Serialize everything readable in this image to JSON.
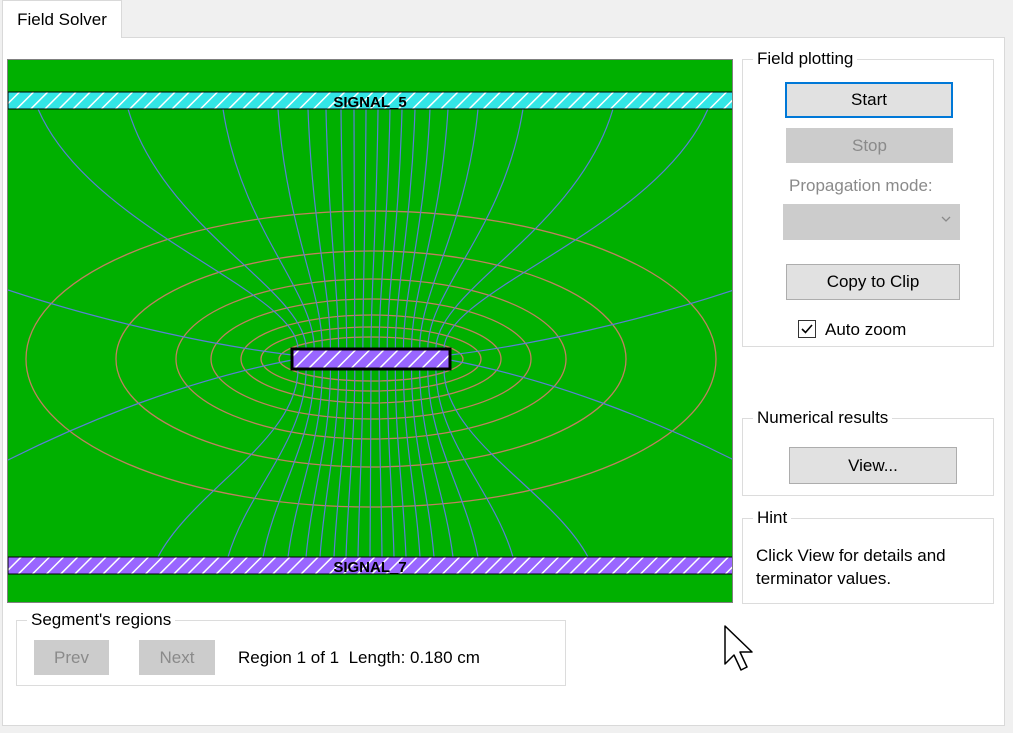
{
  "window": {
    "tab_label": "Field Solver"
  },
  "plot": {
    "top_conductor_label": "SIGNAL_5",
    "bottom_conductor_label": "SIGNAL_7",
    "colors": {
      "background": "#00b000",
      "top_conductor": "#33e6e6",
      "trace_and_bottom": "#9966ff",
      "equipotential_lines": "#c08060",
      "field_lines": "#5a7fd6"
    }
  },
  "field_plotting": {
    "title": "Field plotting",
    "start_label": "Start",
    "stop_label": "Stop",
    "propagation_mode_label": "Propagation mode:",
    "propagation_mode_value": "",
    "copy_label": "Copy to Clip",
    "auto_zoom_label": "Auto zoom",
    "auto_zoom_checked": true
  },
  "numerical_results": {
    "title": "Numerical results",
    "view_label": "View..."
  },
  "hint": {
    "title": "Hint",
    "line1": "Click View for details and",
    "line2": "terminator values."
  },
  "segments": {
    "title": "Segment's regions",
    "prev_label": "Prev",
    "next_label": "Next",
    "region_text": "Region 1 of 1  Length: 0.180 cm"
  }
}
